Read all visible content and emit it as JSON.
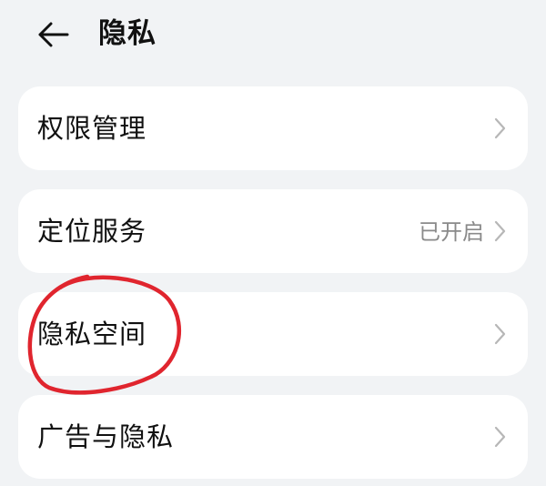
{
  "header": {
    "title": "隐私",
    "back_icon": "arrow-left-icon"
  },
  "items": [
    {
      "label": "权限管理",
      "value": ""
    },
    {
      "label": "定位服务",
      "value": "已开启"
    },
    {
      "label": "隐私空间",
      "value": ""
    },
    {
      "label": "广告与隐私",
      "value": ""
    }
  ],
  "colors": {
    "background": "#f1f3f5",
    "card": "#ffffff",
    "text_primary": "#111111",
    "text_secondary": "#8a8a8a",
    "annotation": "#e0252e"
  }
}
